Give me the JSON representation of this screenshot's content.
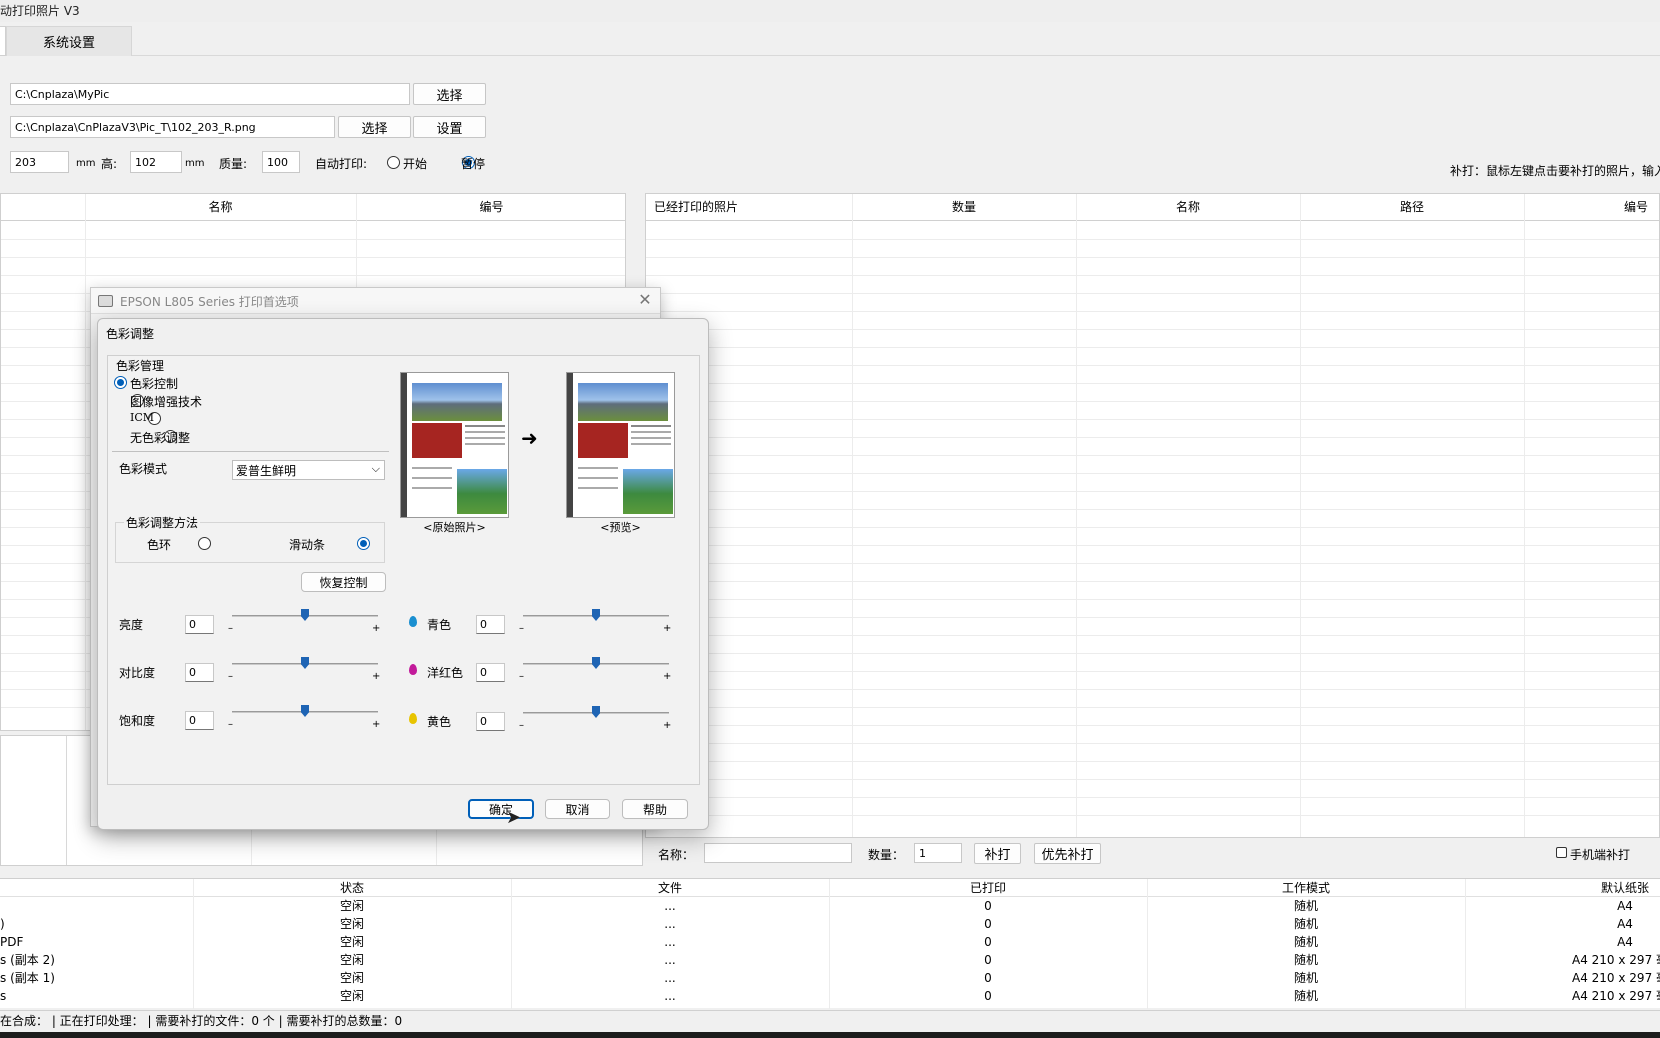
{
  "window": {
    "title": "动打印照片 V3"
  },
  "tabs": {
    "settings": "系统设置"
  },
  "form": {
    "folder_path": "C:\\Cnplaza\\MyPic",
    "template_path": "C:\\Cnplaza\\CnPlazaV3\\Pic_T\\102_203_R.png",
    "select_label": "选择",
    "settings_label": "设置",
    "width_value": "203",
    "unit_mm": "mm",
    "height_label": "高:",
    "height_value": "102",
    "quality_label": "质量:",
    "quality_value": "100",
    "auto_print_label": "自动打印:",
    "start_label": "开始",
    "pause_label": "暂停",
    "reprint_hint": "补打：鼠标左键点击要补打的照片，输入"
  },
  "left_table": {
    "headers": [
      "名称",
      "编号"
    ]
  },
  "right_table": {
    "headers": [
      "已经打印的照片",
      "数量",
      "名称",
      "路径",
      "编号"
    ]
  },
  "reprint_bar": {
    "name_label": "名称：",
    "name_value": "",
    "qty_label": "数量：",
    "qty_value": "1",
    "reprint_button": "补打",
    "priority_button": "优先补打",
    "phone_reprint": "手机端补打"
  },
  "printer_table": {
    "headers": [
      "状态",
      "文件",
      "已打印",
      "工作模式",
      "默认纸张"
    ],
    "rows": [
      {
        "name": "",
        "status": "空闲",
        "file": "...",
        "printed": "0",
        "mode": "随机",
        "paper": "A4"
      },
      {
        "name": ")",
        "status": "空闲",
        "file": "...",
        "printed": "0",
        "mode": "随机",
        "paper": "A4"
      },
      {
        "name": "PDF",
        "status": "空闲",
        "file": "...",
        "printed": "0",
        "mode": "随机",
        "paper": "A4"
      },
      {
        "name": "s (副本 2)",
        "status": "空闲",
        "file": "...",
        "printed": "0",
        "mode": "随机",
        "paper": "A4 210 x 297 毫"
      },
      {
        "name": "s (副本 1)",
        "status": "空闲",
        "file": "...",
        "printed": "0",
        "mode": "随机",
        "paper": "A4 210 x 297 毫"
      },
      {
        "name": "s",
        "status": "空闲",
        "file": "...",
        "printed": "0",
        "mode": "随机",
        "paper": "A4 210 x 297 毫"
      }
    ]
  },
  "status_bar": {
    "text": "在合成：  |  正在打印处理：  |  需要补打的文件：0 个  |  需要补打的总数量：0"
  },
  "printer_dialog": {
    "title": "EPSON L805 Series 打印首选项"
  },
  "color_dialog": {
    "title": "色彩调整",
    "color_management": "色彩管理",
    "options": [
      "色彩控制",
      "图像增强技术",
      "ICM",
      "无色彩调整"
    ],
    "selected_option": 0,
    "color_mode_label": "色彩模式",
    "color_mode_value": "爱普生鲜明",
    "method_group": "色彩调整方法",
    "method_ring": "色环",
    "method_slider": "滑动条",
    "reset_button": "恢复控制",
    "original_caption": "<原始照片>",
    "preview_caption": "<预览>",
    "sliders_left": [
      {
        "label": "亮度",
        "value": "0",
        "level": 0.5
      },
      {
        "label": "对比度",
        "value": "0",
        "level": 0.5
      },
      {
        "label": "饱和度",
        "value": "0",
        "level": 0.5
      }
    ],
    "sliders_right": [
      {
        "label": "青色",
        "value": "0",
        "level": 0.5,
        "color": "#1a8fd0"
      },
      {
        "label": "洋红色",
        "value": "0",
        "level": 0.5,
        "color": "#c21a9a"
      },
      {
        "label": "黄色",
        "value": "0",
        "level": 0.5,
        "color": "#e8c400"
      }
    ],
    "minus": "–",
    "plus": "+",
    "ok_button": "确定",
    "cancel_button": "取消",
    "help_button": "帮助"
  }
}
